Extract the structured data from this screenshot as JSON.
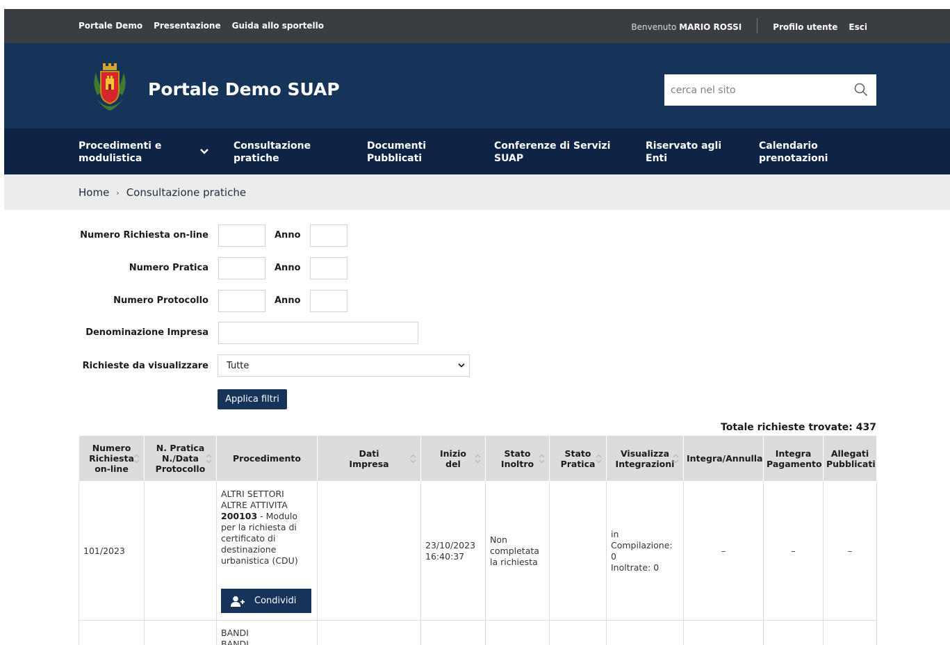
{
  "topbar": {
    "links": [
      "Portale Demo",
      "Presentazione",
      "Guida allo sportello"
    ],
    "welcome_prefix": "Benvenuto",
    "user_name": "MARIO ROSSI",
    "profile_label": "Profilo utente",
    "logout_label": "Esci"
  },
  "header": {
    "site_title": "Portale Demo SUAP",
    "search_placeholder": "cerca nel sito"
  },
  "nav": {
    "items": [
      {
        "line1": "Procedimenti e",
        "line2": "modulistica"
      },
      {
        "line1": "Consultazione",
        "line2": "pratiche"
      },
      {
        "line1": "Documenti",
        "line2": "Pubblicati"
      },
      {
        "line1": "Conferenze di Servizi",
        "line2": "SUAP"
      },
      {
        "line1": "Riservato agli",
        "line2": "Enti"
      },
      {
        "line1": "Calendario",
        "line2": "prenotazioni"
      }
    ]
  },
  "breadcrumb": {
    "home": "Home",
    "current": "Consultazione pratiche"
  },
  "filters": {
    "numero_richiesta": "Numero Richiesta on-line",
    "numero_pratica": "Numero Pratica",
    "numero_protocollo": "Numero Protocollo",
    "anno": "Anno",
    "denominazione": "Denominazione Impresa",
    "richieste_label": "Richieste da visualizzare",
    "richieste_value": "Tutte",
    "apply_label": "Applica filtri"
  },
  "total": "Totale richieste trovate: 437",
  "table": {
    "headers": [
      {
        "l1": "Numero",
        "l2": "Richiesta",
        "l3": "on-line"
      },
      {
        "l1": "N. Pratica",
        "l2": "N./Data",
        "l3": "Protocollo"
      },
      {
        "l1": "Procedimento",
        "l2": "",
        "l3": ""
      },
      {
        "l1": "Dati",
        "l2": "Impresa",
        "l3": ""
      },
      {
        "l1": "Inizio",
        "l2": "del",
        "l3": ""
      },
      {
        "l1": "Stato",
        "l2": "Inoltro",
        "l3": ""
      },
      {
        "l1": "Stato",
        "l2": "Pratica",
        "l3": ""
      },
      {
        "l1": "Visualizza",
        "l2": "Integrazioni",
        "l3": ""
      },
      {
        "l1": "Integra/Annulla",
        "l2": "",
        "l3": ""
      },
      {
        "l1": "Integra",
        "l2": "Pagamento",
        "l3": ""
      },
      {
        "l1": "Allegati",
        "l2": "Pubblicati",
        "l3": ""
      }
    ],
    "rows": [
      {
        "numero": "101/2023",
        "pratica": "",
        "proc_l1": "ALTRI SETTORI",
        "proc_l2": "ALTRE ATTIVITA",
        "proc_code": "200103",
        "proc_desc": " - Modulo per la richiesta di certificato di destinazione urbanistica (CDU)",
        "share_label": "Condividi",
        "impresa": "",
        "inizio_data": "23/10/2023",
        "inizio_ora": "16:40:37",
        "stato_inoltro": "Non completata la richiesta",
        "stato_pratica": "",
        "integr_comp": "in Compilazione: 0",
        "integr_inol": "Inoltrate: 0",
        "integra": "–",
        "pagamento": "–",
        "allegati": "–"
      },
      {
        "proc_l1": "BANDI",
        "proc_l2": "BANDI"
      }
    ]
  },
  "colors": {
    "topbar": "#3a3d41",
    "header": "#16335a",
    "nav": "#0e2444",
    "button": "#16335a"
  }
}
